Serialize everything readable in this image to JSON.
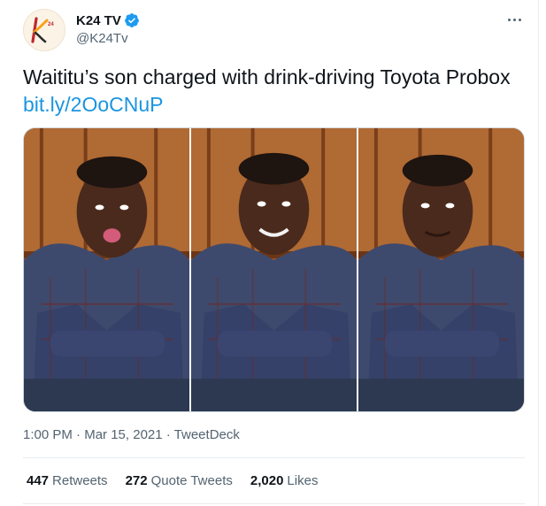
{
  "author": {
    "display_name": "K24 TV",
    "handle": "@K24Tv",
    "avatar_icon": "k24-logo",
    "verified": true,
    "verified_color": "#1d9bf0"
  },
  "tweet": {
    "text": "Waititu’s son charged with drink-driving Toyota Probox",
    "link": "bit.ly/2OoCNuP",
    "link_color": "#1b95e0",
    "photos": [
      "photo-1",
      "photo-2",
      "photo-3"
    ]
  },
  "meta": {
    "time": "1:00 PM",
    "separator_1": " · ",
    "date": "Mar 15, 2021",
    "separator_2": " · ",
    "source": "TweetDeck"
  },
  "stats": {
    "retweets_count": "447",
    "retweets_label": "Retweets",
    "quotes_count": "272",
    "quotes_label": "Quote Tweets",
    "likes_count": "2,020",
    "likes_label": "Likes"
  },
  "icons": {
    "more": "more-options-icon",
    "verified": "verified-badge-icon"
  }
}
